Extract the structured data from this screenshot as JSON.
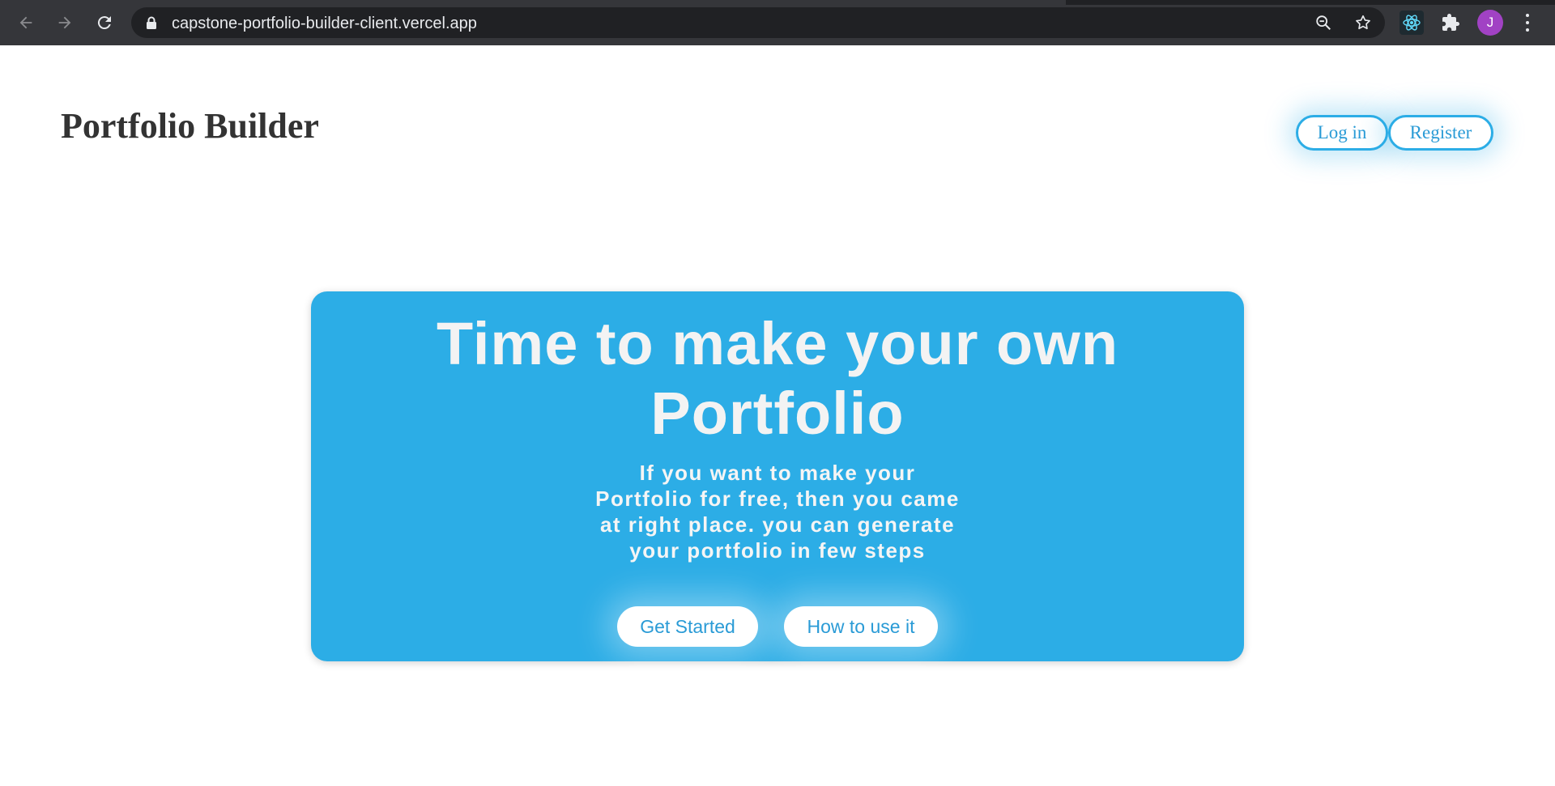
{
  "browser": {
    "url": "capstone-portfolio-builder-client.vercel.app",
    "avatar_initial": "J",
    "icons": {
      "back": "arrow-left-icon",
      "forward": "arrow-right-icon",
      "reload": "reload-icon",
      "lock": "lock-icon",
      "zoom": "zoom-out-icon",
      "bookmark": "star-icon",
      "react_devtools": "react-icon",
      "extensions": "puzzle-icon",
      "menu": "kebab-menu-icon"
    }
  },
  "header": {
    "brand": "Portfolio Builder",
    "login_label": "Log in",
    "register_label": "Register"
  },
  "hero": {
    "title_line1": "Time to make your own",
    "title_line2": "Portfolio",
    "subtitle": "If you want to make your Portfolio for free, then you came at right place. you can generate your portfolio in few steps",
    "get_started_label": "Get Started",
    "how_to_label": "How to use it"
  },
  "colors": {
    "accent": "#2cade6",
    "chrome": "#35363a",
    "omnibox": "#202124",
    "avatar": "#a142c4"
  }
}
